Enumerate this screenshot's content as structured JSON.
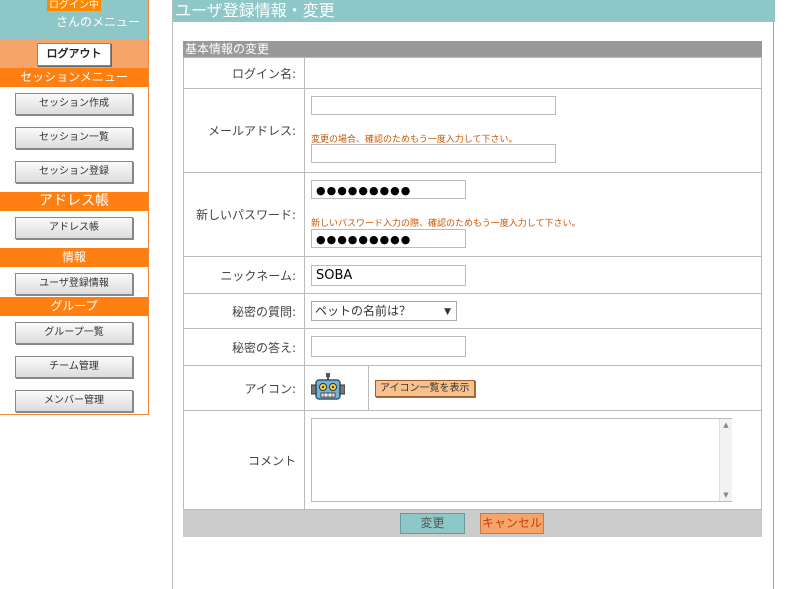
{
  "sidebar": {
    "status": "ログイン中",
    "menu_title": "さんのメニュー",
    "logout": "ログアウト",
    "sections": [
      {
        "title": "セッションメニュー",
        "items": [
          "セッション作成",
          "セッション一覧",
          "セッション登録"
        ]
      },
      {
        "title": "アドレス帳",
        "items": [
          "アドレス帳"
        ]
      },
      {
        "title": "情報",
        "items": [
          "ユーザ登録情報"
        ]
      },
      {
        "title": "グループ",
        "items": [
          "グループ一覧",
          "チーム管理",
          "メンバー管理"
        ]
      }
    ]
  },
  "page": {
    "title": "ユーザ登録情報・変更",
    "section": "基本情報の変更"
  },
  "form": {
    "login_label": "ログイン名:",
    "email_label": "メールアドレス:",
    "email_value": "",
    "email_confirm_value": "",
    "email_note": "変更の場合、確認のためもう一度入力して下さい。",
    "password_label": "新しいパスワード:",
    "password_value": "●●●●●●●●●",
    "password_note": "新しいパスワード入力の際、確認のためもう一度入力して下さい。",
    "password_confirm_value": "●●●●●●●●●",
    "nickname_label": "ニックネーム:",
    "nickname_value": "SOBA",
    "question_label": "秘密の質問:",
    "question_value": "ペットの名前は？",
    "answer_label": "秘密の答え:",
    "answer_value": "",
    "icon_label": "アイコン:",
    "icon_button": "アイコン一覧を表示",
    "comment_label": "コメント",
    "comment_value": ""
  },
  "buttons": {
    "submit": "変更",
    "cancel": "キャンセル"
  },
  "colors": {
    "teal": "#8ec7c8",
    "orange": "#ff7f12",
    "light_orange": "#f7a46a",
    "note_text": "#cc5500"
  }
}
